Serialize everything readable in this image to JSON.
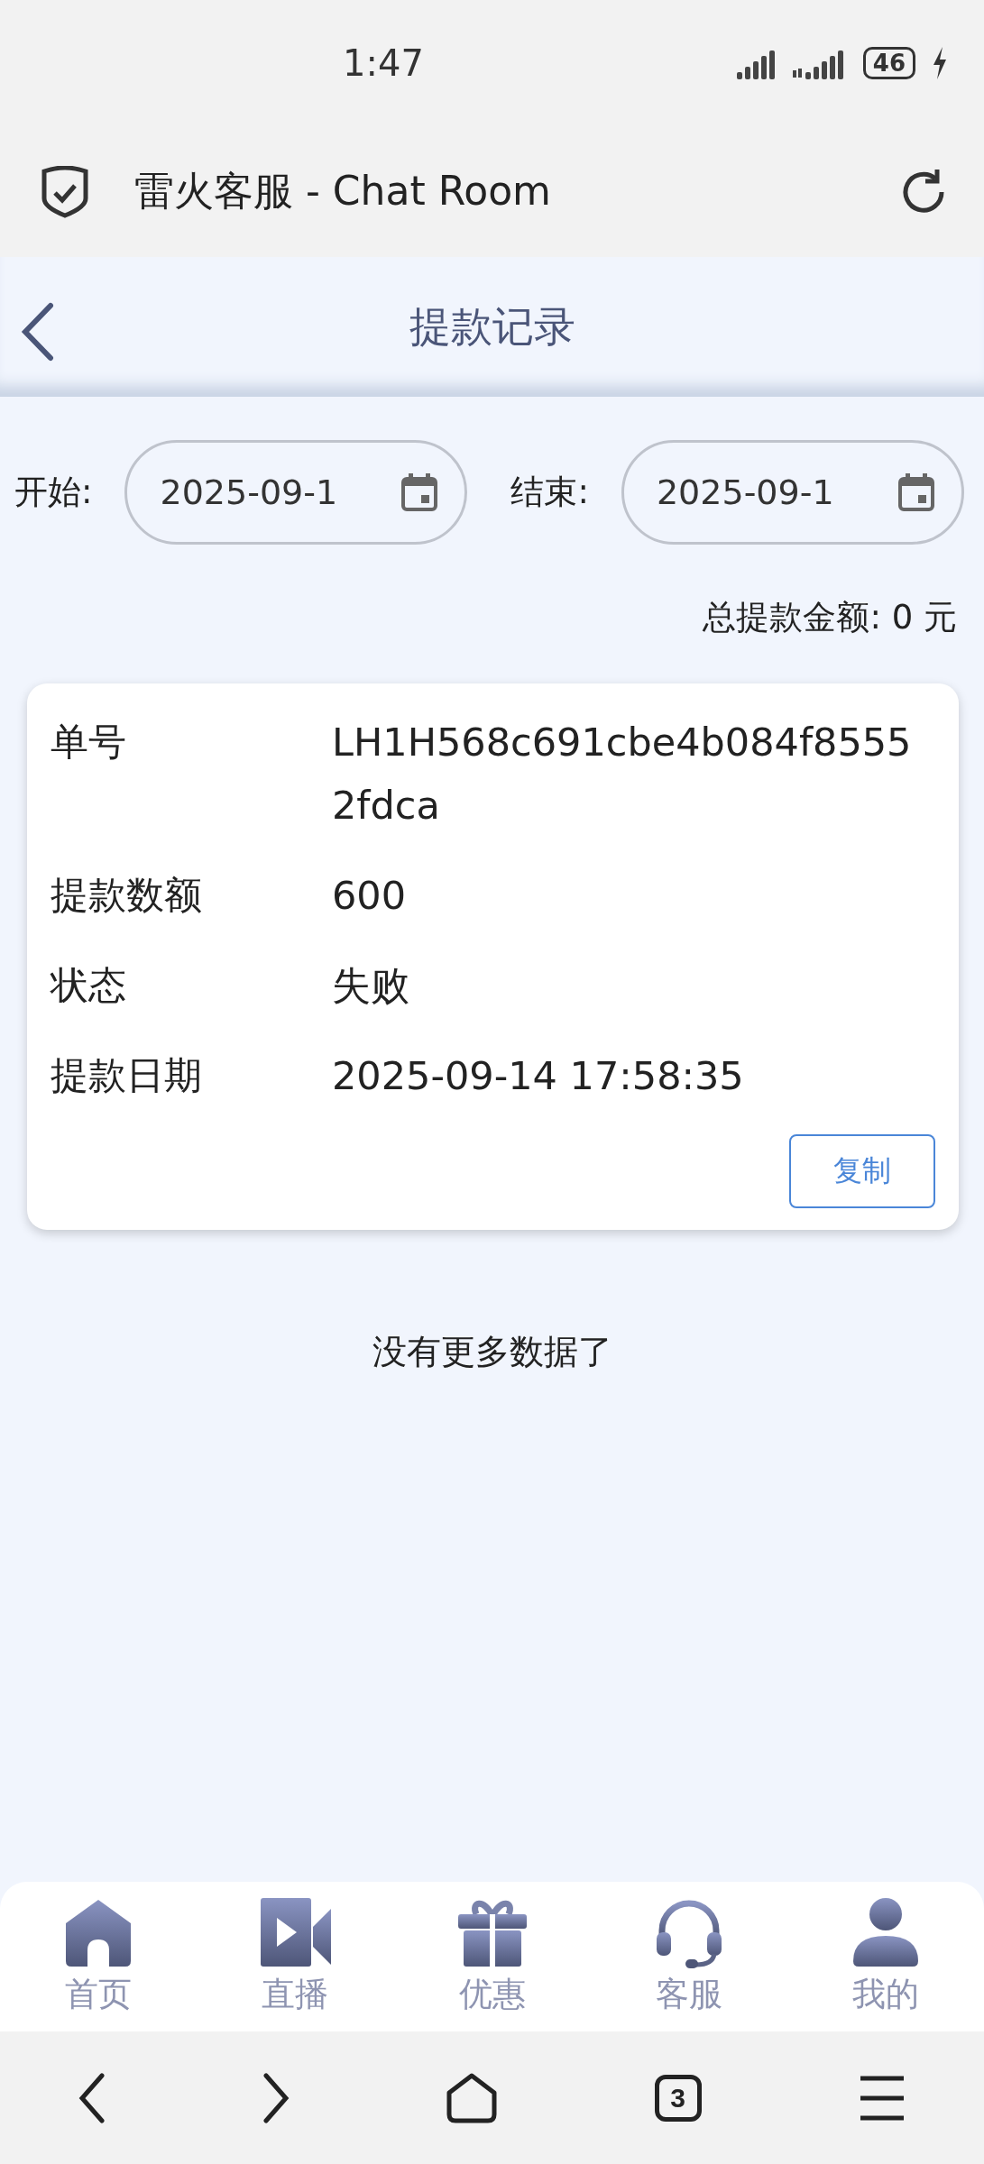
{
  "status_bar": {
    "time": "1:47",
    "battery": "46",
    "charging": true
  },
  "browser": {
    "title": "雷火客服 - Chat Room"
  },
  "header": {
    "title": "提款记录"
  },
  "filters": [
    {
      "label": "开始:",
      "value": "2025-09-1"
    },
    {
      "label": "结束:",
      "value": "2025-09-1"
    }
  ],
  "total": "总提款金额: 0 元",
  "records": [
    {
      "fields": [
        {
          "label": "单号",
          "value": "LH1H568c691cbe4b084f85552fdca"
        },
        {
          "label": "提款数额",
          "value": "600"
        },
        {
          "label": "状态",
          "value": "失败"
        },
        {
          "label": "提款日期",
          "value": "2025-09-14 17:58:35"
        }
      ],
      "button": "复制"
    }
  ],
  "end_note": "没有更多数据了",
  "tabs": [
    {
      "kind": "home",
      "label": "首页"
    },
    {
      "kind": "live",
      "label": "直播"
    },
    {
      "kind": "gift",
      "label": "优惠"
    },
    {
      "kind": "support",
      "label": "客服"
    },
    {
      "kind": "user",
      "label": "我的"
    }
  ],
  "system_nav": {
    "tab_count": "3"
  }
}
